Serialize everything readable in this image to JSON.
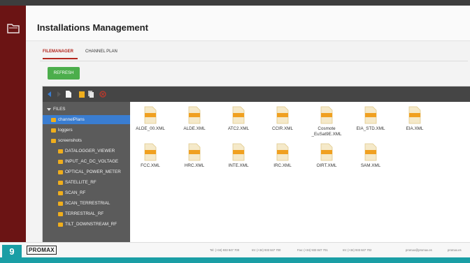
{
  "page_badge": "9",
  "header": {
    "title": "Installations Management"
  },
  "tabs": [
    {
      "label": "FILEMANAGER",
      "active": true
    },
    {
      "label": "CHANNEL PLAN",
      "active": false
    }
  ],
  "refresh_label": "REFRESH",
  "toolbar_icons": [
    "back-icon",
    "forward-icon",
    "new-file-icon",
    "new-folder-icon",
    "copy-icon",
    "delete-icon"
  ],
  "tree": [
    {
      "label": "FILES",
      "level": 0,
      "icon": "caret-down-icon"
    },
    {
      "label": "channelPlans",
      "level": 1,
      "selected": true
    },
    {
      "label": "loggers",
      "level": 1
    },
    {
      "label": "screenshots",
      "level": 1
    },
    {
      "label": "DATALOGGER_VIEWER",
      "level": 2
    },
    {
      "label": "INPUT_AC_DC_VOLTAGE",
      "level": 2
    },
    {
      "label": "OPTICAL_POWER_METER",
      "level": 2
    },
    {
      "label": "SATELLITE_RF",
      "level": 2
    },
    {
      "label": "SCAN_RF",
      "level": 2
    },
    {
      "label": "SCAN_TERRESTRIAL",
      "level": 2
    },
    {
      "label": "TERRESTRIAL_RF",
      "level": 2
    },
    {
      "label": "TILT_DOWNSTREAM_RF",
      "level": 2
    }
  ],
  "files": [
    {
      "name": "ALDE_00.XML"
    },
    {
      "name": "ALDE.XML"
    },
    {
      "name": "ATC2.XML"
    },
    {
      "name": "CCIR.XML"
    },
    {
      "name": "Cosmote _EuSat9E.XML"
    },
    {
      "name": "EIA_STD.XML"
    },
    {
      "name": "EIA.XML"
    },
    {
      "name": "FCC.XML"
    },
    {
      "name": "HRC.XML"
    },
    {
      "name": "INTE.XML"
    },
    {
      "name": "IRC.XML"
    },
    {
      "name": "OIRT.XML"
    },
    {
      "name": "SAM.XML"
    }
  ],
  "footer": {
    "logo": "PROMAX",
    "contacts": [
      "Tel: (+34) 933 847 700",
      "Int: (+34) 933 847 700",
      "Fax: (+34) 933 847 701",
      "Int: (+34) 933 847 702",
      "promax@promax.es",
      "promax.es"
    ]
  },
  "colors": {
    "sidebar": "#6b1414",
    "accent_tab": "#b3261e",
    "refresh": "#4cae4c",
    "selected": "#3a7dd1",
    "folder": "#f0ae1c",
    "teal": "#1a9ea5"
  }
}
